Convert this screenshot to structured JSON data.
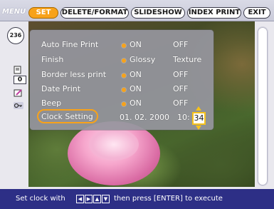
{
  "menu": {
    "label": "MENU",
    "tabs": [
      {
        "label": "SET",
        "active": true
      },
      {
        "label": "DELETE/FORMAT",
        "active": false
      },
      {
        "label": "SLIDESHOW",
        "active": false
      },
      {
        "label": "INDEX PRINT",
        "active": false
      },
      {
        "label": "EXIT",
        "active": false
      }
    ]
  },
  "sidebar": {
    "image_count": "236",
    "copies": "0",
    "icons": [
      "print-copies-icon",
      "edit-icon",
      "protect-key-icon"
    ]
  },
  "settings": {
    "rows": [
      {
        "label": "Auto Fine Print",
        "options": [
          "ON",
          "OFF"
        ],
        "selected": "ON"
      },
      {
        "label": "Finish",
        "options": [
          "Glossy",
          "Texture"
        ],
        "selected": "Glossy"
      },
      {
        "label": "Border less print",
        "options": [
          "ON",
          "OFF"
        ],
        "selected": "ON"
      },
      {
        "label": "Date Print",
        "options": [
          "ON",
          "OFF"
        ],
        "selected": "ON"
      },
      {
        "label": "Beep",
        "options": [
          "ON",
          "OFF"
        ],
        "selected": "ON"
      }
    ],
    "clock": {
      "label": "Clock Setting",
      "date": "01. 02. 2000",
      "hour": "10:",
      "minute": "34"
    }
  },
  "hint": {
    "prefix": "Set clock with",
    "keys": [
      "◀",
      "▶",
      "▲",
      "▼"
    ],
    "suffix": "then press [ENTER] to execute"
  },
  "colors": {
    "accent": "#f7a21a",
    "hint_bar": "#2d2f86",
    "panel": "#96969e"
  }
}
